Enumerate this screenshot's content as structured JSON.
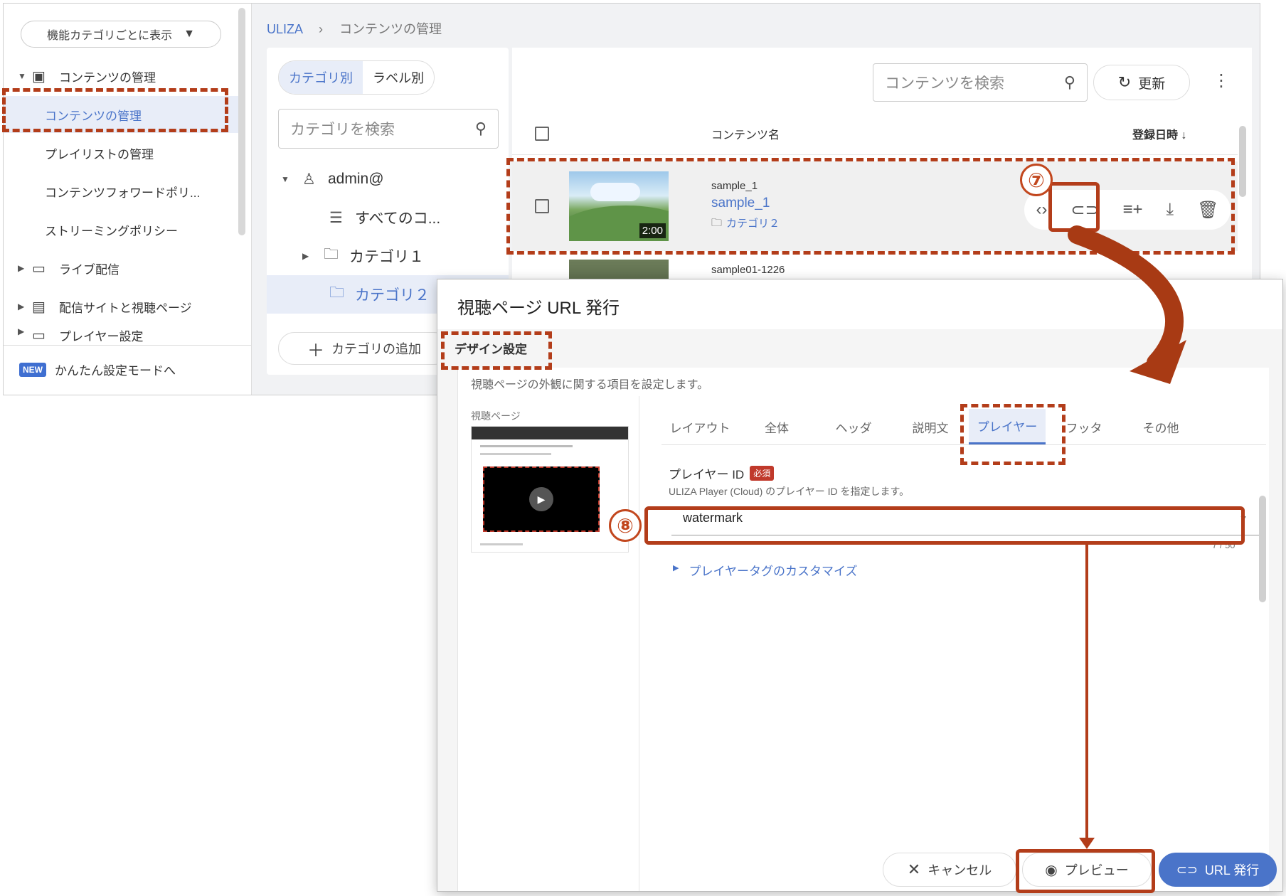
{
  "sidebar": {
    "view_selector": "機能カテゴリごとに表示",
    "items": [
      {
        "label": "コンテンツの管理"
      },
      {
        "label": "コンテンツの管理"
      },
      {
        "label": "プレイリストの管理"
      },
      {
        "label": "コンテンツフォワードポリ..."
      },
      {
        "label": "ストリーミングポリシー"
      },
      {
        "label": "ライブ配信"
      },
      {
        "label": "配信サイトと視聴ページ"
      },
      {
        "label": "プレイヤー設定"
      }
    ],
    "new_badge": "NEW",
    "easy_mode": "かんたん設定モードへ"
  },
  "breadcrumb": {
    "root": "ULIZA",
    "sep": "›",
    "current": "コンテンツの管理"
  },
  "category_panel": {
    "seg_category": "カテゴリ別",
    "seg_label": "ラベル別",
    "search_placeholder": "カテゴリを検索",
    "tree": [
      {
        "label": "admin@"
      },
      {
        "label": "すべてのコ..."
      },
      {
        "label": "カテゴリ１"
      },
      {
        "label": "カテゴリ２"
      }
    ],
    "add_category": "カテゴリの追加"
  },
  "content_panel": {
    "search_placeholder": "コンテンツを検索",
    "refresh": "更新",
    "col_name": "コンテンツ名",
    "col_date": "登録日時 ↓",
    "rows": [
      {
        "id": "sample_1",
        "title": "sample_1",
        "category": "カテゴリ２",
        "duration": "2:00"
      },
      {
        "id": "sample01-1226"
      }
    ]
  },
  "annotations": {
    "step7": "⑦",
    "step8": "⑧"
  },
  "dialog": {
    "title": "視聴ページ URL 発行",
    "section": "デザイン設定",
    "description": "視聴ページの外観に関する項目を設定します。",
    "preview_label": "視聴ページ",
    "tabs": [
      "レイアウト",
      "全体",
      "ヘッダ",
      "説明文",
      "プレイヤー",
      "フッタ",
      "その他"
    ],
    "active_tab": "プレイヤー",
    "player_id_label": "プレイヤー ID",
    "required_badge": "必須",
    "player_id_help": "ULIZA Player (Cloud) のプレイヤー ID を指定します。",
    "player_id_value": "watermark",
    "char_count": "7 / 50",
    "customize_link": "プレイヤータグのカスタマイズ",
    "cancel": "キャンセル",
    "preview": "プレビュー",
    "issue_url": "URL 発行"
  },
  "colors": {
    "accent": "#4a74c9",
    "annotation": "#b33d1a",
    "selected_bg": "#e8edf8"
  }
}
